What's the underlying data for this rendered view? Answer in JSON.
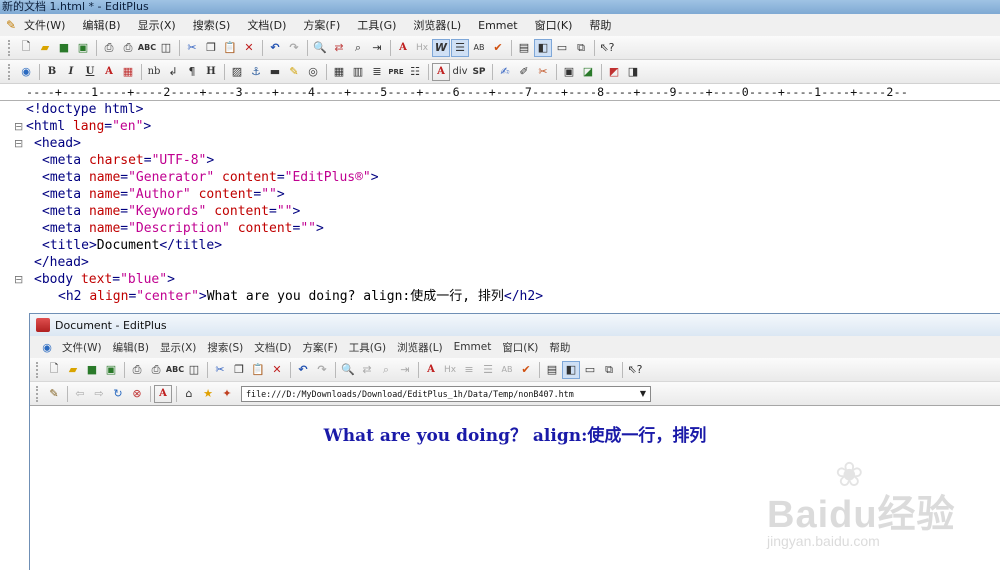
{
  "main_window": {
    "title": "新的文档 1.html * - EditPlus",
    "menu": [
      "文件(W)",
      "编辑(B)",
      "显示(X)",
      "搜索(S)",
      "文档(D)",
      "方案(F)",
      "工具(G)",
      "浏览器(L)",
      "Emmet",
      "窗口(K)",
      "帮助"
    ],
    "format_toolbar_text": {
      "nb": "nb",
      "div": "div",
      "sp": "SP",
      "pre": "PRE",
      "h": "H",
      "hx": "Hx"
    },
    "ruler": "----+----1----+----2----+----3----+----4----+----5----+----6----+----7----+----8----+----9----+----0----+----1----+----2--"
  },
  "editor": {
    "lines": [
      "<!doctype html>",
      "<html lang=\"en\">",
      "<head>",
      "<meta charset=\"UTF-8\">",
      "<meta name=\"Generator\" content=\"EditPlus®\">",
      "<meta name=\"Author\" content=\"\">",
      "<meta name=\"Keywords\" content=\"\">",
      "<meta name=\"Description\" content=\"\">",
      "<title>Document</title>",
      "</head>",
      "<body text=\"blue\">",
      "<h2 align=\"center\">What are you doing? align:使成一行, 排列</h2>"
    ]
  },
  "browser_window": {
    "title": "Document - EditPlus",
    "menu": [
      "文件(W)",
      "编辑(B)",
      "显示(X)",
      "搜索(S)",
      "文档(D)",
      "方案(F)",
      "工具(G)",
      "浏览器(L)",
      "Emmet",
      "窗口(K)",
      "帮助"
    ],
    "url": "file:///D:/MyDownloads/Download/EditPlus_1h/Data/Temp/nonB407.htm",
    "heading": "What are you doing？ align:使成一行，排列",
    "heading_color": "#1a1aa8"
  },
  "watermark": {
    "logo_text": "Baidu经验",
    "url_text": "jingyan.baidu.com"
  },
  "colors": {
    "tag": "#000080",
    "attribute": "#c00000",
    "value": "#c00090"
  }
}
